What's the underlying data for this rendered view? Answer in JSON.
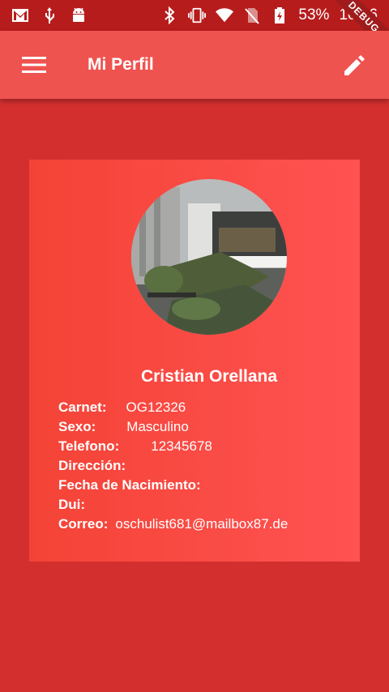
{
  "status_bar": {
    "battery_percent": "53%",
    "time": "10:46",
    "debug_banner": "DEBUG",
    "left_icons": [
      "gmail-icon",
      "usb-icon",
      "android-icon"
    ],
    "right_icons": [
      "bluetooth-icon",
      "vibrate-icon",
      "wifi-icon",
      "no-sim-icon",
      "battery-charging-icon"
    ]
  },
  "app_bar": {
    "title": "Mi Perfil",
    "color": "#ef5350",
    "menu_icon": "menu-icon",
    "edit_icon": "edit-icon"
  },
  "profile": {
    "name": "Cristian  Orellana",
    "photo_icon": "profile-photo",
    "fields": {
      "carnet": {
        "label": "Carnet:",
        "value": "OG12326"
      },
      "sexo": {
        "label": "Sexo:",
        "value": "Masculino"
      },
      "telefono": {
        "label": "Telefono:",
        "value": "12345678"
      },
      "direccion": {
        "label": "Dirección:",
        "value": ""
      },
      "fecha_nacimiento": {
        "label": "Fecha de Nacimiento:",
        "value": ""
      },
      "dui": {
        "label": "Dui:",
        "value": ""
      },
      "correo": {
        "label": "Correo:",
        "value": "oschulist681@mailbox87.de"
      }
    }
  },
  "colors": {
    "background": "#d32f2f",
    "status_bar": "#b71c1c",
    "card_gradient_start": "#f44336",
    "card_gradient_end": "#ff5252"
  }
}
